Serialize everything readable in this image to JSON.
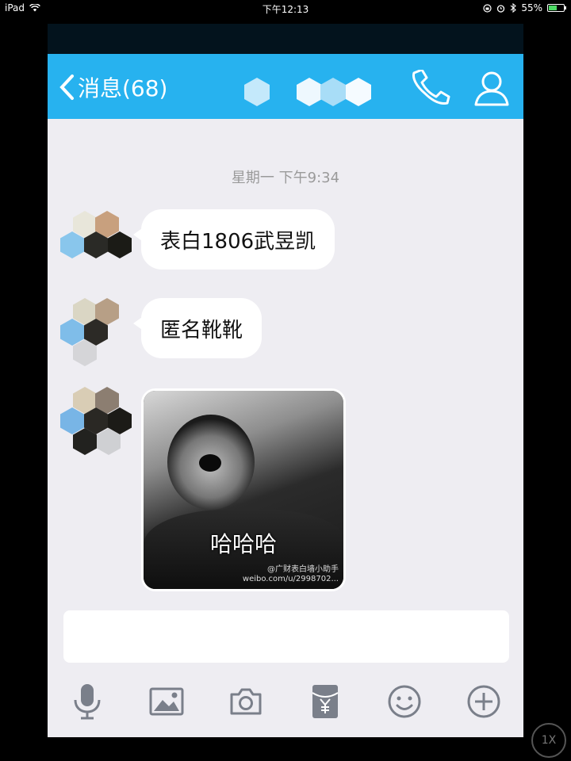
{
  "status_bar": {
    "device": "iPad",
    "time": "下午12:13",
    "battery": "55%",
    "battery_level": 0.55
  },
  "navbar": {
    "back_label": "消息(68)",
    "call_icon": "phone-icon",
    "profile_icon": "person-icon"
  },
  "chat": {
    "timestamp": "星期一 下午9:34",
    "messages": [
      {
        "type": "text",
        "text": "表白1806武昱凯"
      },
      {
        "type": "text",
        "text": "匿名靴靴"
      },
      {
        "type": "image",
        "caption": "哈哈哈",
        "watermark_line1": "@广财表白墙小助手",
        "watermark_line2": "weibo.com/u/2998702..."
      }
    ]
  },
  "toolbar": {
    "items": [
      "microphone-icon",
      "picture-icon",
      "camera-icon",
      "red-packet-icon",
      "emoji-icon",
      "plus-icon"
    ]
  },
  "zoom": {
    "label": "1X"
  },
  "colors": {
    "nav_blue": "#27b2ef",
    "chat_bg": "#eeedf2",
    "bubble": "#ffffff",
    "icon_gray": "#7a7f8a"
  }
}
